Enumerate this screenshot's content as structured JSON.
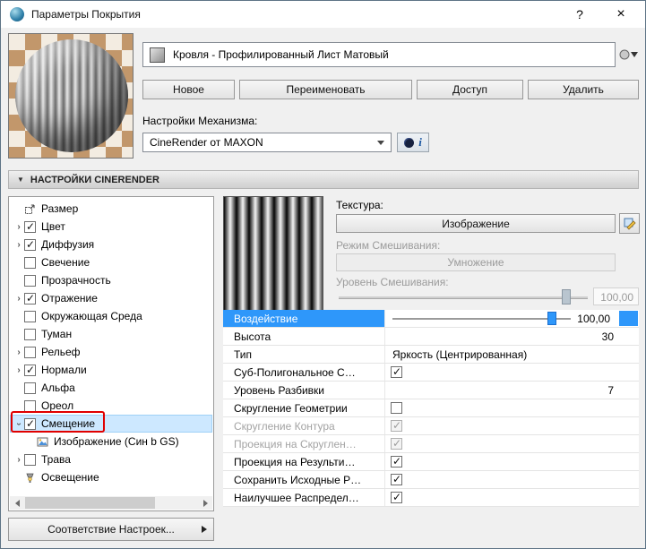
{
  "window": {
    "title": "Параметры Покрытия",
    "help": "?",
    "close": "×"
  },
  "material": {
    "name": "Кровля - Профилированный Лист Матовый",
    "buttons": [
      "Новое",
      "Переименовать",
      "Доступ",
      "Удалить"
    ],
    "engine_label": "Настройки Механизма:",
    "engine_value": "CineRender от MAXON",
    "info_label": "i"
  },
  "section": {
    "title": "НАСТРОЙКИ CINERENDER",
    "collapse_icon": "▼"
  },
  "tree": {
    "items": [
      {
        "label": "Размер",
        "icon": "resize-icon"
      },
      {
        "label": "Цвет",
        "checkbox": true,
        "expander": "collapsed"
      },
      {
        "label": "Диффузия",
        "checkbox": true,
        "expander": "collapsed"
      },
      {
        "label": "Свечение",
        "checkbox": false
      },
      {
        "label": "Прозрачность",
        "checkbox": false
      },
      {
        "label": "Отражение",
        "checkbox": true,
        "expander": "collapsed"
      },
      {
        "label": "Окружающая Среда",
        "checkbox": false
      },
      {
        "label": "Туман",
        "checkbox": false
      },
      {
        "label": "Рельеф",
        "checkbox": false,
        "expander": "collapsed"
      },
      {
        "label": "Нормали",
        "checkbox": true,
        "expander": "collapsed"
      },
      {
        "label": "Альфа",
        "checkbox": false
      },
      {
        "label": "Ореол",
        "checkbox": false
      },
      {
        "label": "Смещение",
        "checkbox": true,
        "expander": "expanded",
        "selected": true,
        "annotated": true
      },
      {
        "label": "Изображение (Син b GS)",
        "icon": "image-icon",
        "child": true
      },
      {
        "label": "Трава",
        "checkbox": false,
        "expander": "collapsed"
      },
      {
        "label": "Освещение",
        "icon": "lamp-icon"
      }
    ],
    "match_button": "Соответствие Настроек..."
  },
  "panel": {
    "texture_label": "Текстура:",
    "texture_button": "Изображение",
    "blend_mode_label": "Режим Смешивания:",
    "blend_mode_value": "Умножение",
    "blend_level_label": "Уровень Смешивания:",
    "blend_level_value": "100,00",
    "rows": [
      {
        "label": "Воздействие",
        "type": "slider",
        "value": "100,00",
        "selected": true
      },
      {
        "label": "Высота",
        "type": "value",
        "value": "30"
      },
      {
        "label": "Тип",
        "type": "text",
        "value": "Яркость (Центрированная)"
      },
      {
        "label": "Суб-Полигональное С…",
        "type": "checkbox",
        "checked": true
      },
      {
        "label": "Уровень Разбивки",
        "type": "value",
        "value": "7"
      },
      {
        "label": "Скругление Геометрии",
        "type": "checkbox",
        "checked": false
      },
      {
        "label": "Скругление Контура",
        "type": "checkbox",
        "checked": true,
        "disabled": true
      },
      {
        "label": "Проекция на Скруглен…",
        "type": "checkbox",
        "checked": true,
        "disabled": true
      },
      {
        "label": "Проекция на Результи…",
        "type": "checkbox",
        "checked": true
      },
      {
        "label": "Сохранить Исходные Р…",
        "type": "checkbox",
        "checked": true
      },
      {
        "label": "Наилучшее Распредел…",
        "type": "checkbox",
        "checked": true
      }
    ]
  },
  "colors": {
    "accent_blue": "#2e97fa",
    "selection": "#cde8ff",
    "annotation_red": "#e00000"
  },
  "icons": {
    "checkmark": "✓",
    "expander_collapsed": "›"
  }
}
